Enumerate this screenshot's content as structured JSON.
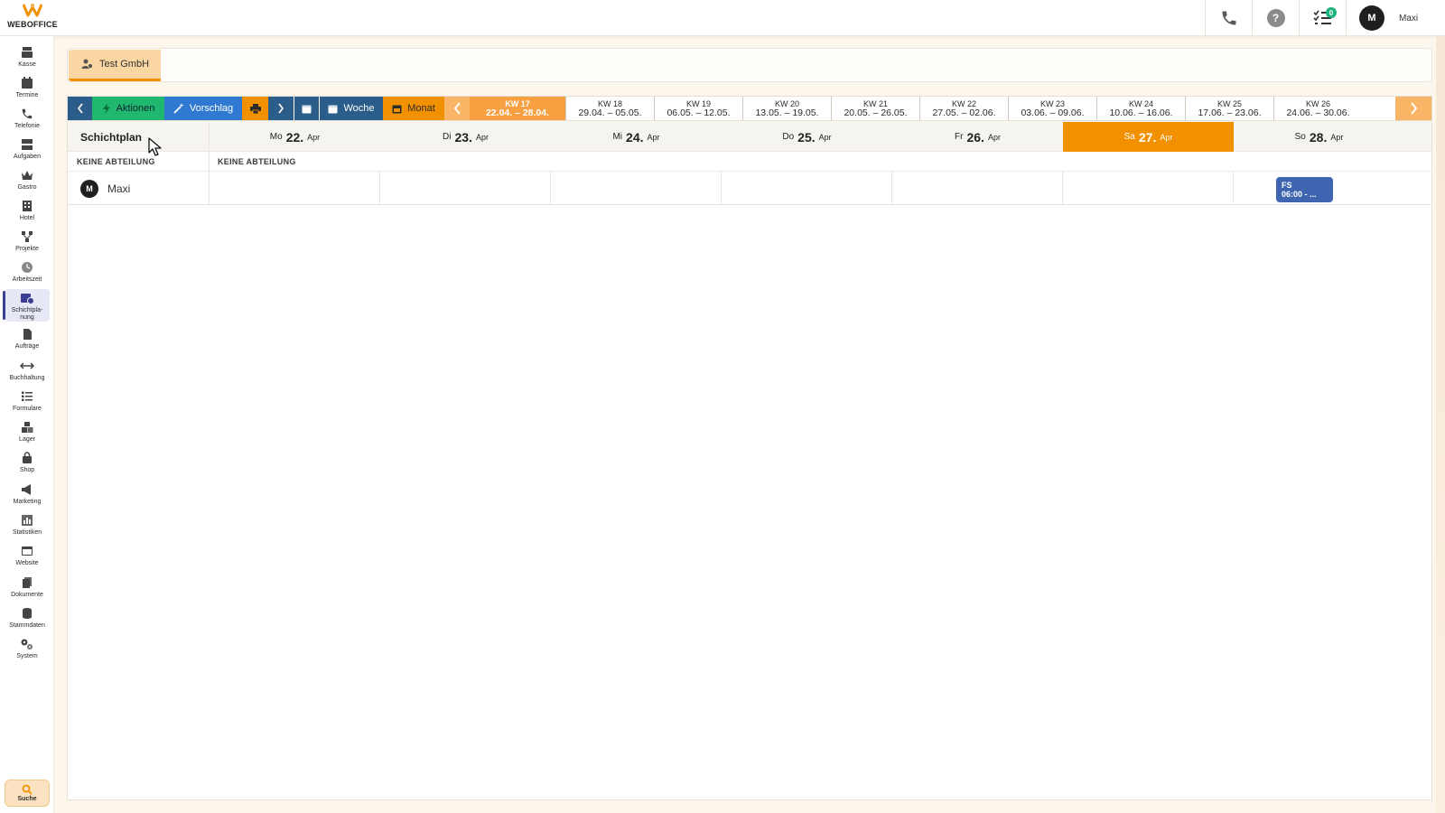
{
  "brand": {
    "name": "WEBOFFICE",
    "color": "#f29100"
  },
  "topbar": {
    "user": {
      "initial": "M",
      "name": "Maxi"
    },
    "tasks_badge": "0"
  },
  "sidebar": {
    "items": [
      {
        "label": "Kasse",
        "icon": "register-icon"
      },
      {
        "label": "Termine",
        "icon": "calendar-icon"
      },
      {
        "label": "Telefonie",
        "icon": "phone-icon"
      },
      {
        "label": "Aufgaben",
        "icon": "tasks-icon"
      },
      {
        "label": "Gastro",
        "icon": "crown-icon"
      },
      {
        "label": "Hotel",
        "icon": "hotel-icon"
      },
      {
        "label": "Projekte",
        "icon": "project-icon"
      },
      {
        "label": "Arbeitszeit",
        "icon": "clock-icon"
      },
      {
        "label": "Schichtpla-nung",
        "icon": "shift-calendar-icon",
        "active": true
      },
      {
        "label": "Aufträge",
        "icon": "document-icon"
      },
      {
        "label": "Buchhaltung",
        "icon": "arrows-icon"
      },
      {
        "label": "Formulare",
        "icon": "checklist-icon"
      },
      {
        "label": "Lager",
        "icon": "boxes-icon"
      },
      {
        "label": "Shop",
        "icon": "bag-icon"
      },
      {
        "label": "Marketing",
        "icon": "megaphone-icon"
      },
      {
        "label": "Statistiken",
        "icon": "chart-icon"
      },
      {
        "label": "Website",
        "icon": "browser-icon"
      },
      {
        "label": "Dokumente",
        "icon": "files-icon"
      },
      {
        "label": "Stammdaten",
        "icon": "database-icon"
      },
      {
        "label": "System",
        "icon": "gears-icon"
      }
    ],
    "search_label": "Suche"
  },
  "company": {
    "name": "Test GmbH"
  },
  "toolbar": {
    "actions_label": "Aktionen",
    "suggest_label": "Vorschlag",
    "week_label": "Woche",
    "month_label": "Monat",
    "weeks": [
      {
        "kw": "KW 17",
        "range": "22.04. – 28.04.",
        "active": true
      },
      {
        "kw": "KW 18",
        "range": "29.04. – 05.05."
      },
      {
        "kw": "KW 19",
        "range": "06.05. – 12.05."
      },
      {
        "kw": "KW 20",
        "range": "13.05. – 19.05."
      },
      {
        "kw": "KW 21",
        "range": "20.05. – 26.05."
      },
      {
        "kw": "KW 22",
        "range": "27.05. – 02.06."
      },
      {
        "kw": "KW 23",
        "range": "03.06. – 09.06."
      },
      {
        "kw": "KW 24",
        "range": "10.06. – 16.06."
      },
      {
        "kw": "KW 25",
        "range": "17.06. – 23.06."
      },
      {
        "kw": "KW 26",
        "range": "24.06. – 30.06."
      }
    ]
  },
  "schedule": {
    "title": "Schichtplan",
    "days": [
      {
        "wd": "Mo",
        "num": "22.",
        "mon": "Apr"
      },
      {
        "wd": "Di",
        "num": "23.",
        "mon": "Apr"
      },
      {
        "wd": "Mi",
        "num": "24.",
        "mon": "Apr"
      },
      {
        "wd": "Do",
        "num": "25.",
        "mon": "Apr"
      },
      {
        "wd": "Fr",
        "num": "26.",
        "mon": "Apr"
      },
      {
        "wd": "Sa",
        "num": "27.",
        "mon": "Apr",
        "today": true
      },
      {
        "wd": "So",
        "num": "28.",
        "mon": "Apr"
      }
    ],
    "dept_left": "KEINE ABTEILUNG",
    "dept_right": "KEINE ABTEILUNG",
    "employee": {
      "initial": "M",
      "name": "Maxi"
    },
    "shift": {
      "code": "FS",
      "time": "06:00 - ..."
    },
    "today_color": "#f29100",
    "shift_color": "#3f65b0"
  }
}
